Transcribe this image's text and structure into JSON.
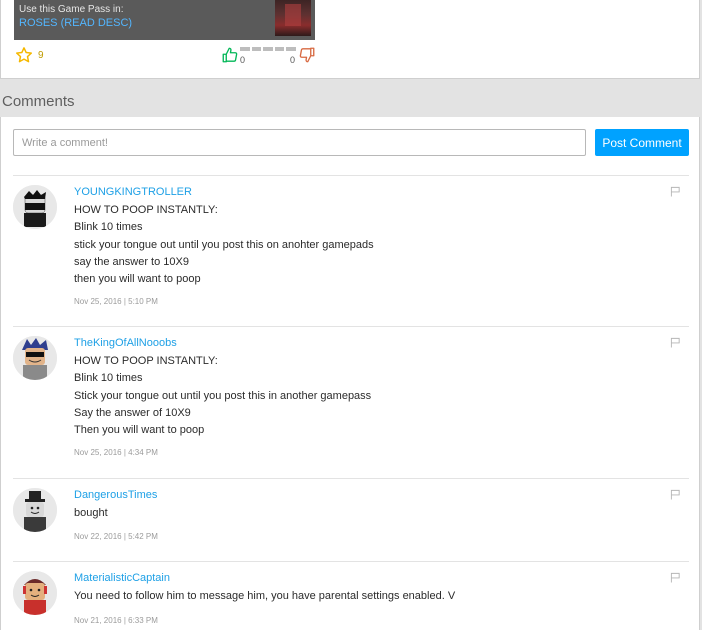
{
  "game_pass": {
    "use_label": "Use this Game Pass in:",
    "place_name": "ROSES (READ DESC)",
    "favorites": "9",
    "upvotes": "0",
    "downvotes": "0"
  },
  "comments": {
    "heading": "Comments",
    "input_placeholder": "Write a comment!",
    "post_label": "Post Comment",
    "items": [
      {
        "username": "YOUNGKINGTROLLER",
        "lines": [
          "HOW TO POOP INSTANTLY:",
          "Blink 10 times",
          "stick your tongue out until you post this on anohter gamepads",
          "say the answer to 10X9",
          "then you will want to poop"
        ],
        "date": "Nov 25, 2016 | 5:10 PM"
      },
      {
        "username": "TheKingOfAllNooobs",
        "lines": [
          "HOW TO POOP INSTANTLY:",
          "Blink 10 times",
          "Stick your tongue out until you post this in another gamepass",
          "Say the answer of 10X9",
          "Then you will want to poop"
        ],
        "date": "Nov 25, 2016 | 4:34 PM"
      },
      {
        "username": "DangerousTimes",
        "lines": [
          "bought"
        ],
        "date": "Nov 22, 2016 | 5:42 PM"
      },
      {
        "username": "MaterialisticCaptain",
        "lines": [
          "You need to follow him to message him, you have parental settings enabled. V"
        ],
        "date": "Nov 21, 2016 | 6:33 PM"
      }
    ]
  },
  "colors": {
    "accent": "#00a2ff",
    "username": "#1ea0e6",
    "star": "#f5b800",
    "thumb_up": "#02b757",
    "thumb_down": "#d86a42"
  }
}
